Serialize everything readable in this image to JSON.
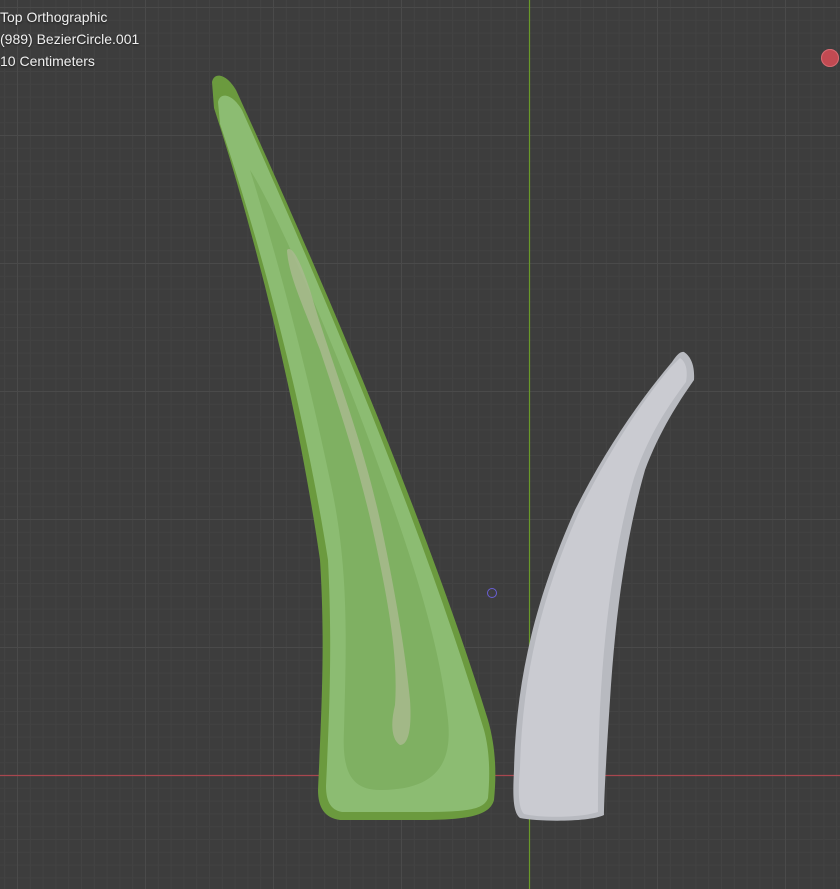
{
  "viewport": {
    "view_name": "Top Orthographic",
    "active_object": "(989) BezierCircle.001",
    "grid_scale": "10 Centimeters"
  },
  "colors": {
    "background": "#3d3d3d",
    "grid_minor": "#434343",
    "grid_major": "#4a4a4a",
    "x_axis": "#a8474f",
    "y_axis": "#6a9a2a",
    "green_object": "#86b46a",
    "grey_object": "#c7c9cf"
  },
  "icons": {
    "gizmo_x": "nav-gizmo-x-axis-icon",
    "origin": "object-origin-icon"
  }
}
